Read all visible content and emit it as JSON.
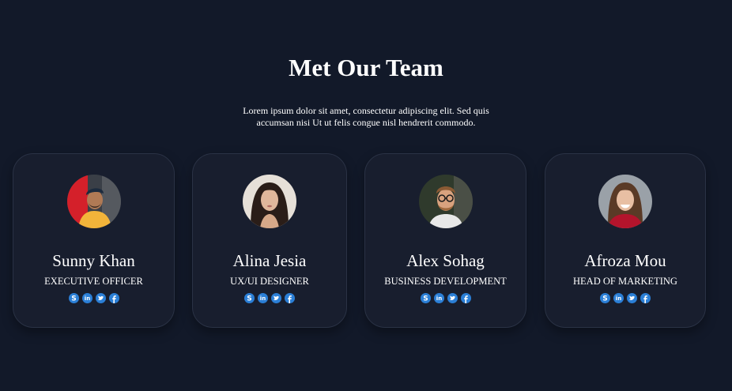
{
  "section": {
    "title": "Met Our Team",
    "description": "Lorem ipsum dolor sit amet, consectetur adipiscing elit. Sed quis accumsan nisi Ut ut felis congue nisl hendrerit commodo."
  },
  "colors": {
    "background": "#121929",
    "card": "#181e2e",
    "card_border": "#2a3245",
    "social_icon": "#2b7fd6",
    "text": "#ffffff"
  },
  "social_icons": [
    "skype-icon",
    "linkedin-icon",
    "twitter-icon",
    "facebook-icon"
  ],
  "team": [
    {
      "name": "Sunny Khan",
      "role": "Executive Officer",
      "avatar": "man-with-cap-avatar"
    },
    {
      "name": "Alina Jesia",
      "role": "UX/UI Designer",
      "avatar": "woman-dark-hair-avatar"
    },
    {
      "name": "Alex Sohag",
      "role": "Business Development",
      "avatar": "man-with-glasses-avatar"
    },
    {
      "name": "Afroza Mou",
      "role": "Head of Marketing",
      "avatar": "smiling-woman-avatar"
    }
  ]
}
